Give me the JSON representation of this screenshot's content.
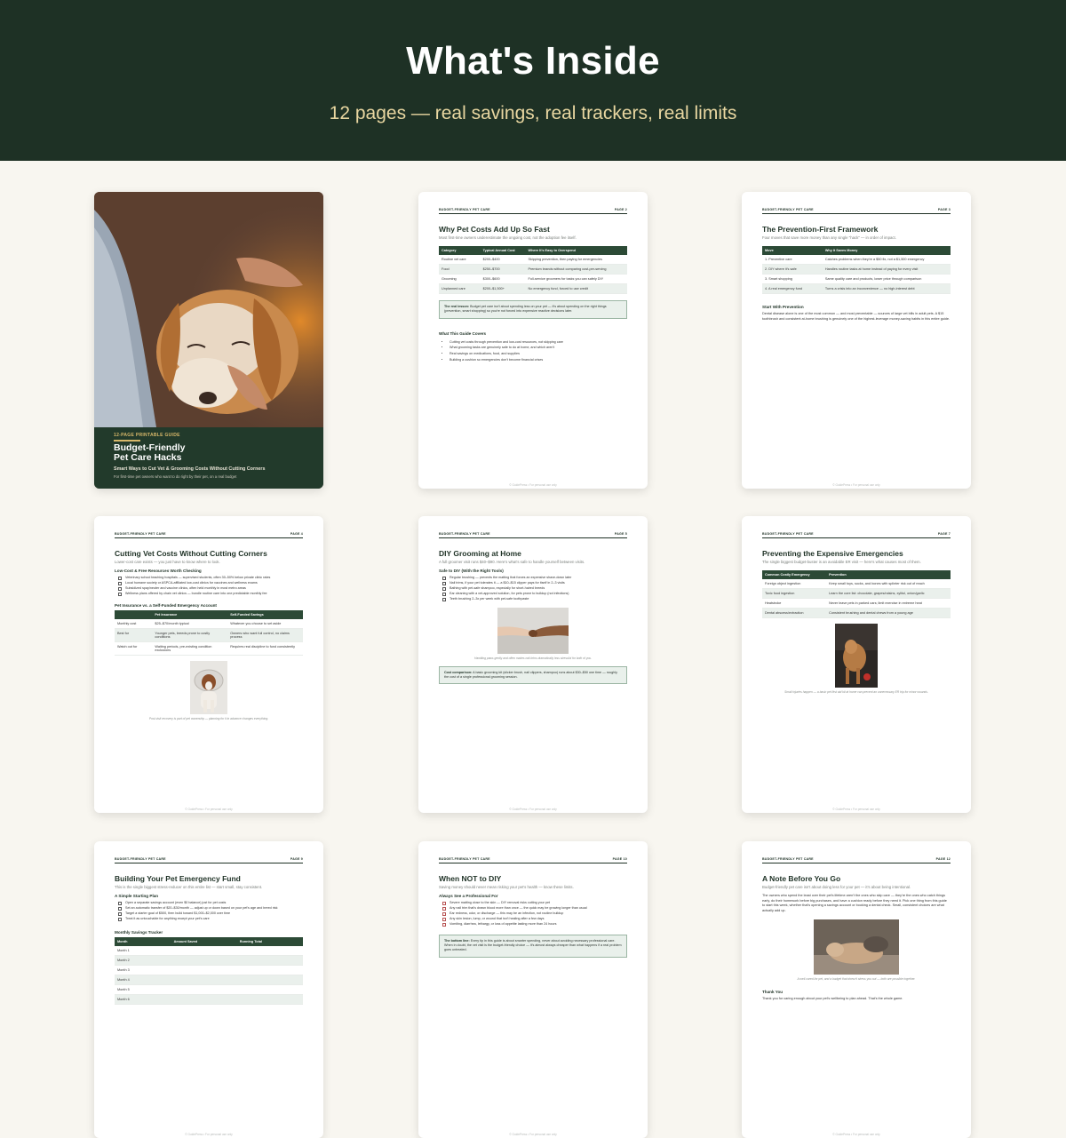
{
  "header": {
    "title": "What's Inside",
    "subtitle": "12 pages — real savings, real trackers, real limits"
  },
  "colors": {
    "header_bg": "#1e3125",
    "accent": "#e9d7a1",
    "table_header": "#2c4a36",
    "page_bg": "#f8f6f0"
  },
  "running_head": "BUDGET-FRIENDLY PET CARE",
  "footer": "© GuidePress • For personal use only",
  "cover": {
    "tag": "12-PAGE PRINTABLE GUIDE",
    "title_line1": "Budget-Friendly",
    "title_line2": "Pet Care Hacks",
    "subtitle": "Smart Ways to Cut Vet & Grooming Costs Without Cutting Corners",
    "note": "For first-time pet owners who want to do right by their pet, on a real budget"
  },
  "p2": {
    "page": "PAGE 2",
    "title": "Why Pet Costs Add Up So Fast",
    "subtitle": "Most first-time owners underestimate the ongoing cost, not the adoption fee itself.",
    "headers": [
      "Category",
      "Typical Annual Cost",
      "Where It's Easy to Overspend"
    ],
    "rows": [
      [
        "Routine vet care",
        "$200–$400",
        "Skipping prevention, then paying for emergencies"
      ],
      [
        "Food",
        "$250–$700",
        "Premium brands without comparing cost-per-serving"
      ],
      [
        "Grooming",
        "$300–$600",
        "Full-service groomers for tasks you can safely DIY"
      ],
      [
        "Unplanned care",
        "$200–$1,500+",
        "No emergency fund, forced to use credit"
      ]
    ],
    "callout_bold": "The real lesson:",
    "callout_text": " Budget pet care isn't about spending less on your pet — it's about spending on the right things (prevention, smart shopping) so you're not forced into expensive reactive decisions later.",
    "section": "What This Guide Covers",
    "bullets": [
      "Cutting vet costs through prevention and low-cost resources, not skipping care",
      "What grooming tasks are genuinely safe to do at home, and which aren't",
      "Real savings on medications, food, and supplies",
      "Building a cushion so emergencies don't become financial crises"
    ]
  },
  "p3": {
    "page": "PAGE 3",
    "title": "The Prevention-First Framework",
    "subtitle": "Four moves that save more money than any single \"hack\" — in order of impact.",
    "headers": [
      "Move",
      "Why It Saves Money"
    ],
    "rows": [
      [
        "1. Preventive care",
        "Catches problems when they're a $50 fix, not a $1,500 emergency"
      ],
      [
        "2. DIY where it's safe",
        "Handles routine tasks at home instead of paying for every visit"
      ],
      [
        "3. Smart shopping",
        "Same quality care and products, lower price through comparison"
      ],
      [
        "4. A real emergency fund",
        "Turns a crisis into an inconvenience — no high-interest debt"
      ]
    ],
    "section": "Start With Prevention",
    "para": "Dental disease alone is one of the most common — and most preventable — sources of large vet bills in adult pets. A $15 toothbrush and consistent at-home brushing is genuinely one of the highest-leverage money-saving habits in this entire guide."
  },
  "p4": {
    "page": "PAGE 4",
    "title": "Cutting Vet Costs Without Cutting Corners",
    "subtitle": "Lower-cost care exists — you just have to know where to look.",
    "section1": "Low-Cost & Free Resources Worth Checking",
    "checks": [
      "Veterinary school teaching hospitals — supervised students, often 30–50% below private clinic rates",
      "Local humane society or ASPCA-affiliated low-cost clinics for vaccines and wellness exams",
      "Subsidized spay/neuter and vaccine clinics, often held monthly in most metro areas",
      "Wellness plans offered by chain vet clinics — bundle routine care into one predictable monthly fee"
    ],
    "section2": "Pet Insurance vs. a Self-Funded Emergency Account",
    "headers": [
      "",
      "Pet Insurance",
      "Self-Funded Savings"
    ],
    "rows": [
      [
        "Monthly cost",
        "$25–$70/month typical",
        "Whatever you choose to set aside"
      ],
      [
        "Best for",
        "Younger pets, breeds prone to costly conditions",
        "Owners who want full control, no claims process"
      ],
      [
        "Watch out for",
        "Waiting periods, pre-existing condition exclusions",
        "Requires real discipline to fund consistently"
      ]
    ],
    "caption": "Post-visit recovery is part of pet ownership — planning for it in advance changes everything."
  },
  "p5": {
    "page": "PAGE 5",
    "title": "DIY Grooming at Home",
    "subtitle": "A full groomer visit runs $40–$90. Here's what's safe to handle yourself between visits.",
    "section": "Safe to DIY (With the Right Tools)",
    "checks": [
      "Regular brushing — prevents the matting that forces an expensive shave-down later",
      "Nail trims, if your pet tolerates it — a $10–$15 clipper pays for itself in 2–3 visits",
      "Bathing with pet-safe shampoo, especially for short-haired breeds",
      "Ear cleaning with a vet-approved solution, for pets prone to buildup (not infections)",
      "Teeth brushing 2–3x per week with pet-safe toothpaste"
    ],
    "caption": "Handling paws gently and often makes nail trims dramatically less stressful for both of you.",
    "callout_bold": "Cost comparison:",
    "callout_text": " A basic grooming kit (slicker brush, nail clippers, shampoo) runs about $30–$50 one time — roughly the cost of a single professional grooming session."
  },
  "p7": {
    "page": "PAGE 7",
    "title": "Preventing the Expensive Emergencies",
    "subtitle": "The single biggest budget-buster is an avoidable ER visit — here's what causes most of them.",
    "headers": [
      "Common Costly Emergency",
      "Prevention"
    ],
    "rows": [
      [
        "Foreign object ingestion",
        "Keep small toys, socks, and bones with splinter risk out of reach"
      ],
      [
        "Toxic food ingestion",
        "Learn the core list: chocolate, grapes/raisins, xylitol, onion/garlic"
      ],
      [
        "Heatstroke",
        "Never leave pets in parked cars; limit exercise in extreme heat"
      ],
      [
        "Dental abscess/extraction",
        "Consistent brushing and dental chews from a young age"
      ]
    ],
    "caption": "Small injuries happen — a basic pet first aid kit at home can prevent an unnecessary ER trip for minor wounds."
  },
  "p9": {
    "page": "PAGE 9",
    "title": "Building Your Pet Emergency Fund",
    "subtitle": "This is the single biggest stress-reducer on this entire list — start small, stay consistent.",
    "section1": "A Simple Starting Plan",
    "checks": [
      "Open a separate savings account (even $0 balance) just for pet costs",
      "Set an automatic transfer of $20–$30/month — adjust up or down based on your pet's age and breed risk",
      "Target a starter goal of $500, then build toward $1,000–$2,000 over time",
      "Treat it as untouchable for anything except your pet's care"
    ],
    "section2": "Monthly Savings Tracker",
    "headers": [
      "Month",
      "Amount Saved",
      "Running Total"
    ],
    "months": [
      "Month 1",
      "Month 2",
      "Month 3",
      "Month 4",
      "Month 5",
      "Month 6"
    ]
  },
  "p10": {
    "page": "PAGE 10",
    "title": "When NOT to DIY",
    "subtitle": "Saving money should never mean risking your pet's health — know these limits.",
    "section": "Always See a Professional For",
    "checks": [
      "Severe matting close to the skin — DIY removal risks cutting your pet",
      "Any nail trim that's drawn blood more than once — the quick may be growing longer than usual",
      "Ear redness, odor, or discharge — this may be an infection, not routine buildup",
      "Any skin lesion, lump, or wound that isn't healing after a few days",
      "Vomiting, diarrhea, lethargy, or loss of appetite lasting more than 24 hours"
    ],
    "callout_bold": "The bottom line:",
    "callout_text": " Every tip in this guide is about smarter spending, never about avoiding necessary professional care. When in doubt, the vet visit is the budget-friendly choice — it's almost always cheaper than what happens if a real problem goes untreated."
  },
  "p12": {
    "page": "PAGE 12",
    "title": "A Note Before You Go",
    "subtitle": "Budget-friendly pet care isn't about doing less for your pet — it's about being intentional.",
    "para": "The owners who spend the least over their pet's lifetime aren't the ones who skip care — they're the ones who catch things early, do their homework before big purchases, and have a cushion ready before they need it. Pick one thing from this guide to start this week, whether that's opening a savings account or booking a dental check. Small, consistent choices are what actually add up.",
    "caption": "A well-cared-for pet, and a budget that doesn't stress you out — both are possible together.",
    "section": "Thank You",
    "thanks": "Thank you for caring enough about your pet's wellbeing to plan ahead. That's the whole game."
  }
}
